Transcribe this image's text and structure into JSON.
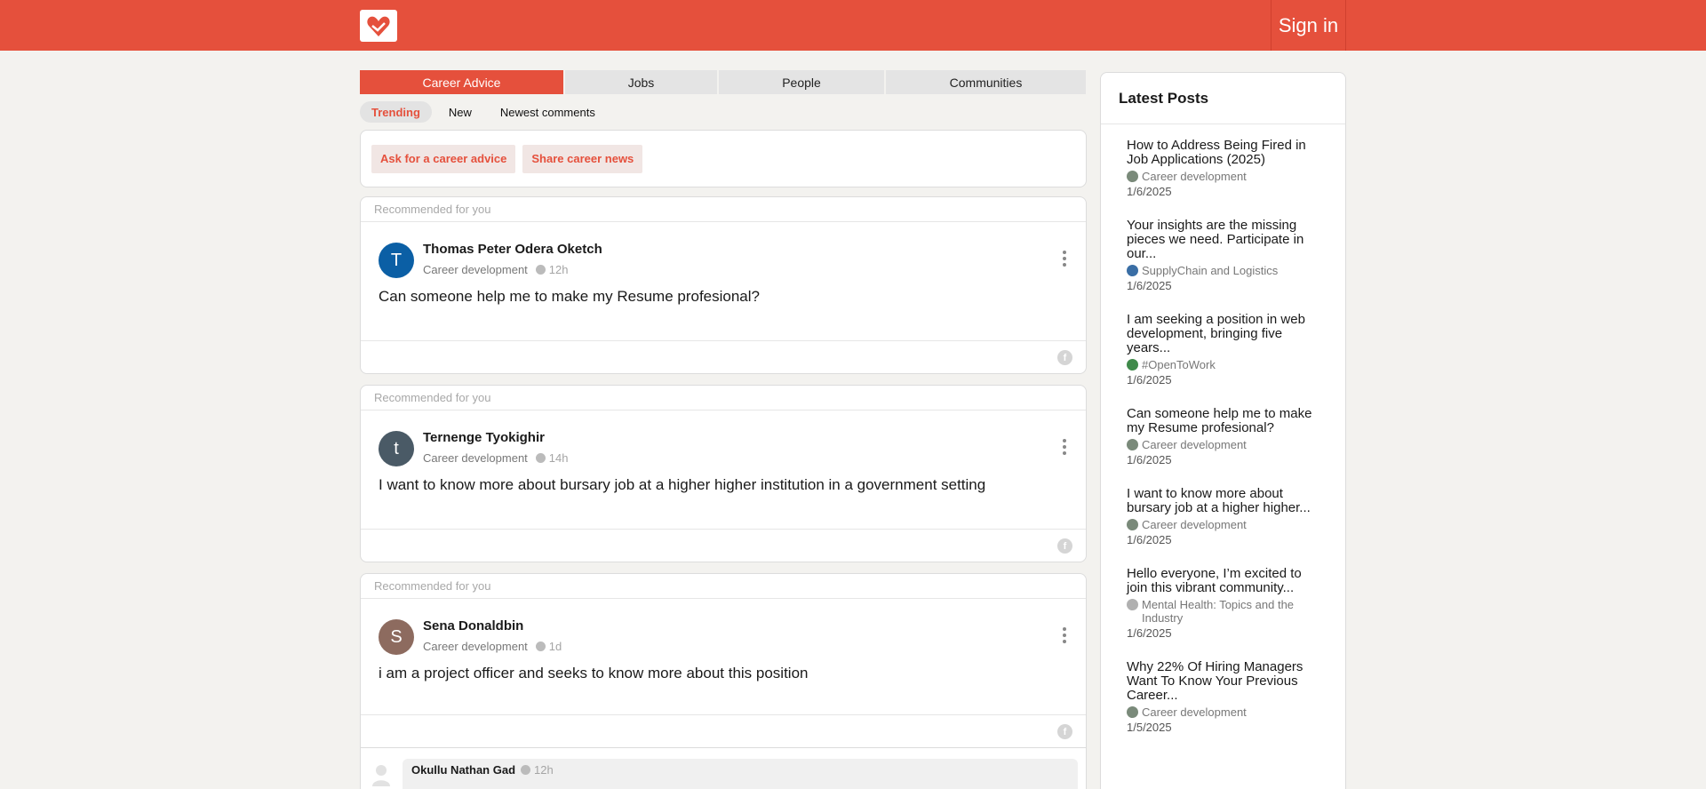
{
  "header": {
    "signin_label": "Sign in"
  },
  "tabs": [
    {
      "label": "Career Advice",
      "active": true
    },
    {
      "label": "Jobs",
      "active": false
    },
    {
      "label": "People",
      "active": false
    },
    {
      "label": "Communities",
      "active": false
    }
  ],
  "sort": [
    {
      "label": "Trending",
      "active": true
    },
    {
      "label": "New",
      "active": false
    },
    {
      "label": "Newest comments",
      "active": false
    }
  ],
  "actions": {
    "ask_label": "Ask for a career advice",
    "share_label": "Share career news"
  },
  "posts": [
    {
      "rec_label": "Recommended for you",
      "initial": "T",
      "avatar_color": "#0b5fa5",
      "author": "Thomas Peter Odera Oketch",
      "category": "Career development",
      "time": "12h",
      "text": "Can someone help me to make my Resume profesional?"
    },
    {
      "rec_label": "Recommended for you",
      "initial": "t",
      "avatar_color": "#4a5a66",
      "author": "Ternenge Tyokighir",
      "category": "Career development",
      "time": "14h",
      "text": "I want to know more about bursary job at a higher higher institution in a government setting"
    },
    {
      "rec_label": "Recommended for you",
      "initial": "S",
      "avatar_color": "#8d6b5f",
      "author": "Sena Donaldbin",
      "category": "Career development",
      "time": "1d",
      "text": "i am a project officer and seeks to know more about this position"
    }
  ],
  "comment": {
    "author": "Okullu Nathan Gad",
    "time": "12h"
  },
  "sidebar": {
    "title": "Latest Posts",
    "items": [
      {
        "title": "How to Address Being Fired in Job Applications (2025)",
        "community": "Career development",
        "date": "1/6/2025",
        "icon_color": "#7a8a7a"
      },
      {
        "title": "Your insights are the missing pieces we need. Participate in our...",
        "community": "SupplyChain and Logistics",
        "date": "1/6/2025",
        "icon_color": "#3a6ea5"
      },
      {
        "title": "I am seeking a position in web development, bringing five years...",
        "community": "#OpenToWork",
        "date": "1/6/2025",
        "icon_color": "#3f8a4a"
      },
      {
        "title": "Can someone help me to make my Resume profesional?",
        "community": "Career development",
        "date": "1/6/2025",
        "icon_color": "#7a8a7a"
      },
      {
        "title": "I want to know more about bursary job at a higher higher...",
        "community": "Career development",
        "date": "1/6/2025",
        "icon_color": "#7a8a7a"
      },
      {
        "title": "Hello everyone, I’m excited to join this vibrant community...",
        "community": "Mental Health: Topics and the Industry",
        "date": "1/6/2025",
        "icon_color": "#b0b0b0"
      },
      {
        "title": "Why 22% Of Hiring Managers Want To Know Your Previous Career...",
        "community": "Career development",
        "date": "1/5/2025",
        "icon_color": "#7a8a7a"
      }
    ]
  }
}
